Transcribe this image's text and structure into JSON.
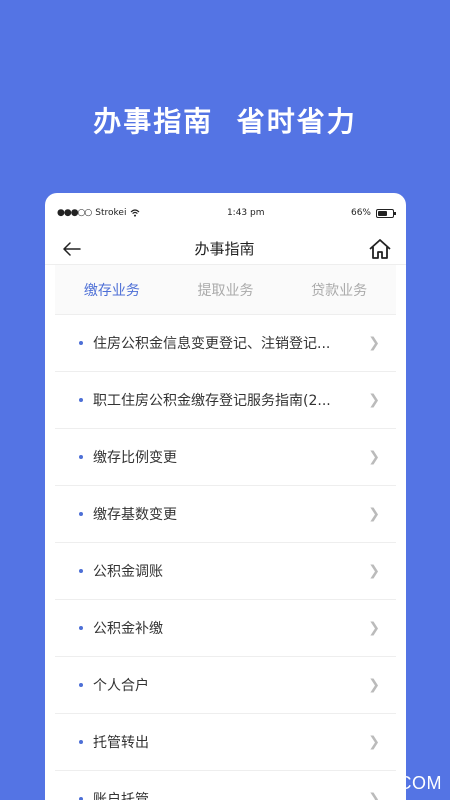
{
  "headline": "办事指南  省时省力",
  "status_bar": {
    "carrier": "Strokei",
    "time": "1:43 pm",
    "battery": "66%",
    "battery_level": 0.66
  },
  "navbar": {
    "title": "办事指南",
    "back_icon": "arrow-left-icon",
    "home_icon": "home-icon"
  },
  "tabs": [
    {
      "label": "缴存业务",
      "active": true
    },
    {
      "label": "提取业务",
      "active": false
    },
    {
      "label": "贷款业务",
      "active": false
    }
  ],
  "items": [
    {
      "label": "住房公积金信息变更登记、注销登记..."
    },
    {
      "label": "职工住房公积金缴存登记服务指南(2..."
    },
    {
      "label": "缴存比例变更"
    },
    {
      "label": "缴存基数变更"
    },
    {
      "label": "公积金调账"
    },
    {
      "label": "公积金补缴"
    },
    {
      "label": "个人合户"
    },
    {
      "label": "托管转出"
    },
    {
      "label": "账户托管"
    }
  ],
  "watermark": "QQTF.COM",
  "colors": {
    "accent": "#4d6fd6",
    "background": "#5474e4"
  }
}
